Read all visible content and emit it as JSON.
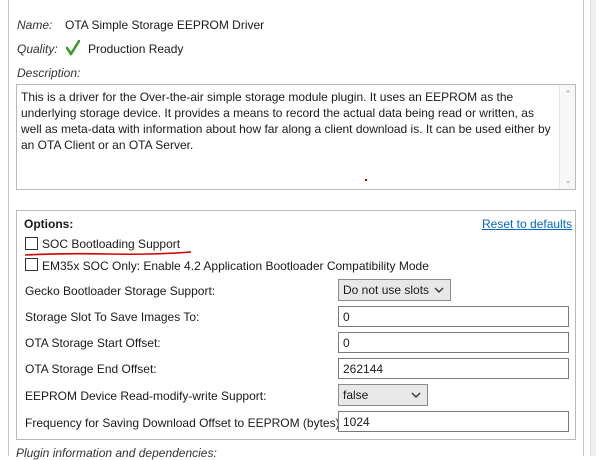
{
  "header": {
    "name_label": "Name:",
    "name_value": "OTA Simple Storage EEPROM Driver",
    "quality_label": "Quality:",
    "quality_value": "Production Ready",
    "description_label": "Description:"
  },
  "description": {
    "text": "This is a driver for the Over-the-air simple storage module plugin.  It uses an EEPROM as the underlying storage device.  It provides a means to record the actual data being read or written, as well as meta-data with information about how far along a client download is.  It can be used either by an OTA Client or an OTA Server."
  },
  "options": {
    "title": "Options:",
    "reset_link": "Reset to defaults",
    "soc_bootloading_label": "SOC Bootloading Support",
    "em35x_label": "EM35x SOC Only:  Enable 4.2 Application Bootloader Compatibility Mode",
    "rows": {
      "gecko_label": "Gecko Bootloader Storage Support:",
      "gecko_value": "Do not use slots",
      "slot_label": "Storage Slot To Save Images To:",
      "slot_value": "0",
      "start_label": "OTA Storage Start Offset:",
      "start_value": "0",
      "end_label": "OTA Storage End Offset:",
      "end_value": "262144",
      "rmw_label": "EEPROM Device Read-modify-write Support:",
      "rmw_value": "false",
      "freq_label": "Frequency for Saving Download Offset to EEPROM (bytes):",
      "freq_value": "1024"
    }
  },
  "footer": {
    "plugin_info_label": "Plugin information and dependencies:"
  },
  "colors": {
    "link": "#0066cc",
    "check_green": "#3a9a2a",
    "annotation_red": "#d40000"
  },
  "icons": {
    "quality": "checkmark-icon",
    "dropdown": "chevron-down-icon"
  }
}
